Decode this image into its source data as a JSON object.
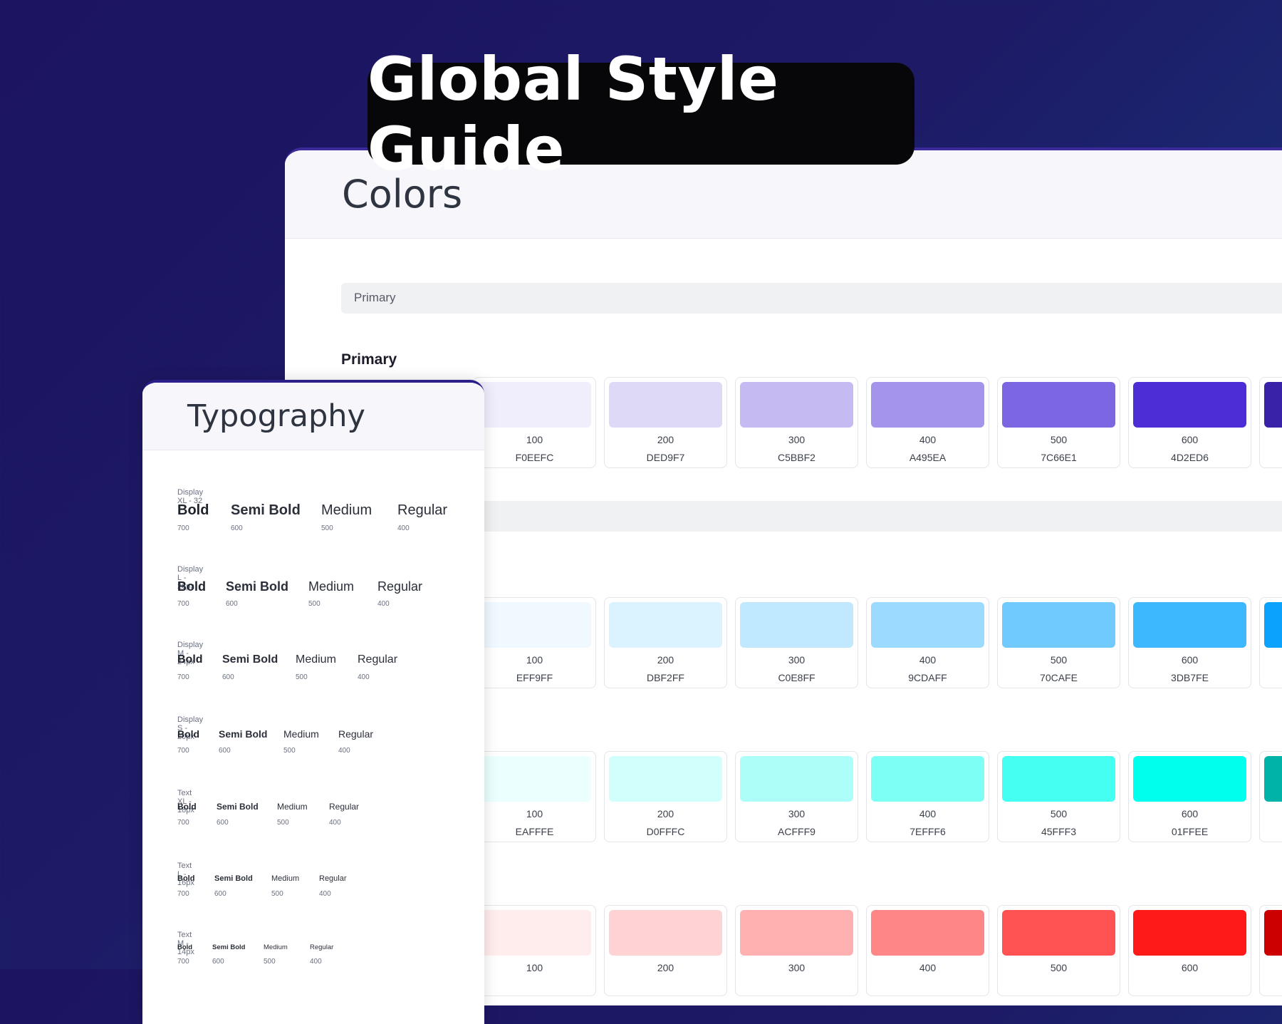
{
  "badge": {
    "title": "Global Style Guide"
  },
  "colors": {
    "title": "Colors",
    "bar_label": "Primary",
    "section_label": "Primary",
    "rows": [
      {
        "swatches": [
          {
            "step": "100",
            "hex": "F0EEFC",
            "color": "#F0EEFC"
          },
          {
            "step": "200",
            "hex": "DED9F7",
            "color": "#DED9F7"
          },
          {
            "step": "300",
            "hex": "C5BBF2",
            "color": "#C5BBF2"
          },
          {
            "step": "400",
            "hex": "A495EA",
            "color": "#A495EA"
          },
          {
            "step": "500",
            "hex": "7C66E1",
            "color": "#7C66E1"
          },
          {
            "step": "600",
            "hex": "4D2ED6",
            "color": "#4D2ED6"
          }
        ],
        "next_color": "#3A22A8"
      },
      {
        "swatches": [
          {
            "step": "100",
            "hex": "EFF9FF",
            "color": "#EFF9FF"
          },
          {
            "step": "200",
            "hex": "DBF2FF",
            "color": "#DBF2FF"
          },
          {
            "step": "300",
            "hex": "C0E8FF",
            "color": "#C0E8FF"
          },
          {
            "step": "400",
            "hex": "9CDAFF",
            "color": "#9CDAFF"
          },
          {
            "step": "500",
            "hex": "70CAFE",
            "color": "#70CAFE"
          },
          {
            "step": "600",
            "hex": "3DB7FE",
            "color": "#3DB7FE"
          }
        ],
        "next_color": "#0AA2FC"
      },
      {
        "swatches": [
          {
            "step": "100",
            "hex": "EAFFFE",
            "color": "#EAFFFE"
          },
          {
            "step": "200",
            "hex": "D0FFFC",
            "color": "#D0FFFC"
          },
          {
            "step": "300",
            "hex": "ACFFF9",
            "color": "#ACFFF9"
          },
          {
            "step": "400",
            "hex": "7EFFF6",
            "color": "#7EFFF6"
          },
          {
            "step": "500",
            "hex": "45FFF3",
            "color": "#45FFF3"
          },
          {
            "step": "600",
            "hex": "01FFEE",
            "color": "#01FFEE"
          }
        ],
        "next_color": "#00B3A8"
      },
      {
        "swatches": [
          {
            "step": "100",
            "hex": "",
            "color": "#FFECEC"
          },
          {
            "step": "200",
            "hex": "",
            "color": "#FFD3D3"
          },
          {
            "step": "300",
            "hex": "",
            "color": "#FFB1B1"
          },
          {
            "step": "400",
            "hex": "",
            "color": "#FF8686"
          },
          {
            "step": "500",
            "hex": "",
            "color": "#FF5252"
          },
          {
            "step": "600",
            "hex": "",
            "color": "#FF1A1A"
          }
        ],
        "next_color": "#CC0000"
      }
    ]
  },
  "typography": {
    "title": "Typography",
    "groups": [
      {
        "label": "Display XL - 32",
        "weights": [
          {
            "name": "Bold",
            "value": "700"
          },
          {
            "name": "Semi Bold",
            "value": "600"
          },
          {
            "name": "Medium",
            "value": "500"
          },
          {
            "name": "Regular",
            "value": "400"
          }
        ]
      },
      {
        "label": "Display L - 28px",
        "weights": [
          {
            "name": "Bold",
            "value": "700"
          },
          {
            "name": "Semi Bold",
            "value": "600"
          },
          {
            "name": "Medium",
            "value": "500"
          },
          {
            "name": "Regular",
            "value": "400"
          }
        ]
      },
      {
        "label": "Display M - 24px",
        "weights": [
          {
            "name": "Bold",
            "value": "700"
          },
          {
            "name": "Semi Bold",
            "value": "600"
          },
          {
            "name": "Medium",
            "value": "500"
          },
          {
            "name": "Regular",
            "value": "400"
          }
        ]
      },
      {
        "label": "Display S - 20px",
        "weights": [
          {
            "name": "Bold",
            "value": "700"
          },
          {
            "name": "Semi Bold",
            "value": "600"
          },
          {
            "name": "Medium",
            "value": "500"
          },
          {
            "name": "Regular",
            "value": "400"
          }
        ]
      },
      {
        "label": "Text XL - 18px",
        "weights": [
          {
            "name": "Bold",
            "value": "700"
          },
          {
            "name": "Semi Bold",
            "value": "600"
          },
          {
            "name": "Medium",
            "value": "500"
          },
          {
            "name": "Regular",
            "value": "400"
          }
        ]
      },
      {
        "label": "Text L - 16px",
        "weights": [
          {
            "name": "Bold",
            "value": "700"
          },
          {
            "name": "Semi Bold",
            "value": "600"
          },
          {
            "name": "Medium",
            "value": "500"
          },
          {
            "name": "Regular",
            "value": "400"
          }
        ]
      },
      {
        "label": "Text M - 14px",
        "weights": [
          {
            "name": "Bold",
            "value": "700"
          },
          {
            "name": "Semi Bold",
            "value": "600"
          },
          {
            "name": "Medium",
            "value": "500"
          },
          {
            "name": "Regular",
            "value": "400"
          }
        ]
      }
    ]
  }
}
